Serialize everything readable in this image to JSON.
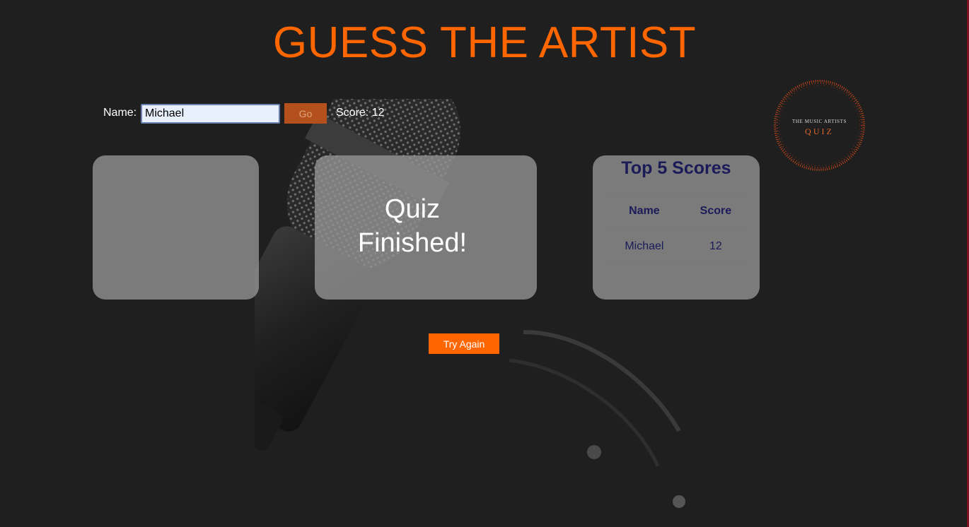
{
  "page": {
    "title": "GUESS THE ARTIST"
  },
  "player": {
    "name_label": "Name:",
    "name_value": "Michael",
    "go_label": "Go",
    "score_text": "Score: 12"
  },
  "logo": {
    "line1": "THE MUSIC ARTISTS",
    "line2": "QUIZ"
  },
  "quiz": {
    "message_line1": "Quiz",
    "message_line2": "Finished!",
    "try_again_label": "Try Again"
  },
  "leaderboard": {
    "title": "Top 5 Scores",
    "columns": [
      "Name",
      "Score"
    ],
    "rows": [
      {
        "name": "Michael",
        "score": "12"
      }
    ]
  },
  "colors": {
    "accent": "#ff6600",
    "background": "#1f1f1f",
    "panel": "#969696",
    "leaderboard_text": "#1b1b5a"
  },
  "icons": {
    "background": "microphone-background",
    "logo": "music-quiz-logo"
  }
}
